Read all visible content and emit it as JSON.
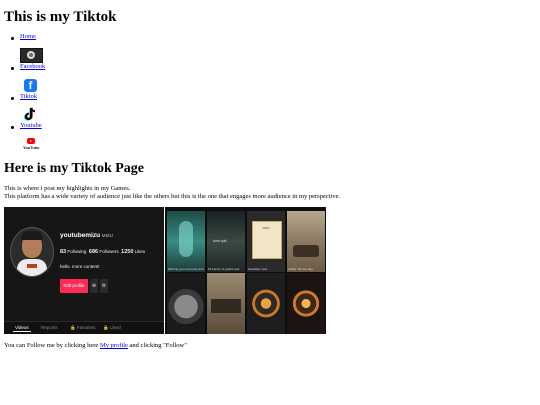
{
  "page": {
    "title": "This is my Tiktok",
    "heading": "Here is my Tiktok Page",
    "paragraph_1": "This is where i post my highlights in my Games.",
    "paragraph_2": "This platform has a wide variety of audience just like the others but this is the one that engages more audience in my perspective."
  },
  "nav": {
    "items": [
      {
        "label": "Home",
        "icon": null
      },
      {
        "label": "Facebook",
        "icon": "facebook-logo-icon"
      },
      {
        "label": "Tiktok",
        "icon": "tiktok-logo-icon"
      },
      {
        "label": "Youtube",
        "icon": "youtube-logo-icon"
      }
    ],
    "pre_icon": "photo-thumbnail-icon",
    "youtube_caption": "YouTube"
  },
  "profile_screenshot": {
    "username": "youtubemizu",
    "display_name": "MIZU",
    "following_count": "83",
    "following_label": "Following",
    "followers_count": "686",
    "followers_label": "Followers",
    "likes_count": "1250",
    "likes_label": "Likes",
    "bio": "hello. more content!",
    "edit_button": "Edit profile",
    "tabs": [
      "Videos",
      "Reposts",
      "Favorites",
      "Liked"
    ]
  },
  "video_grid": {
    "captions": [
      "Missing your accounts and",
      "Mi Factor vs yellow and",
      "Guardian mod",
      "Lobby: 4th ser-day",
      "",
      "",
      "",
      ""
    ],
    "inner_texts": [
      "dont quit",
      "MOD"
    ]
  },
  "footer": {
    "text_before": "You can Follow me by clicking here ",
    "link_label": "My profile",
    "text_after": " and clicking \"Follow\""
  },
  "colors": {
    "link": "#0000ee",
    "tiktok_red": "#fe2c55",
    "facebook_blue": "#1877f2",
    "youtube_red": "#ff0000"
  }
}
